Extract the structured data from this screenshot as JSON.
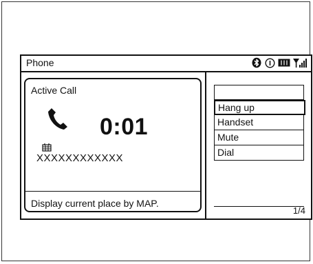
{
  "header": {
    "title": "Phone",
    "status_icons": [
      "bluetooth-icon",
      "info-icon",
      "battery-icon",
      "signal-icon"
    ]
  },
  "call_panel": {
    "title": "Active Call",
    "timer": "0:01",
    "number": "XXXXXXXXXXXX",
    "footer": "Display current place by MAP."
  },
  "menu": {
    "items": [
      {
        "label": ""
      },
      {
        "label": "Hang up",
        "selected": true
      },
      {
        "label": "Handset"
      },
      {
        "label": "Mute"
      },
      {
        "label": "Dial"
      },
      {
        "label": ""
      }
    ],
    "page_indicator": "1/4"
  }
}
